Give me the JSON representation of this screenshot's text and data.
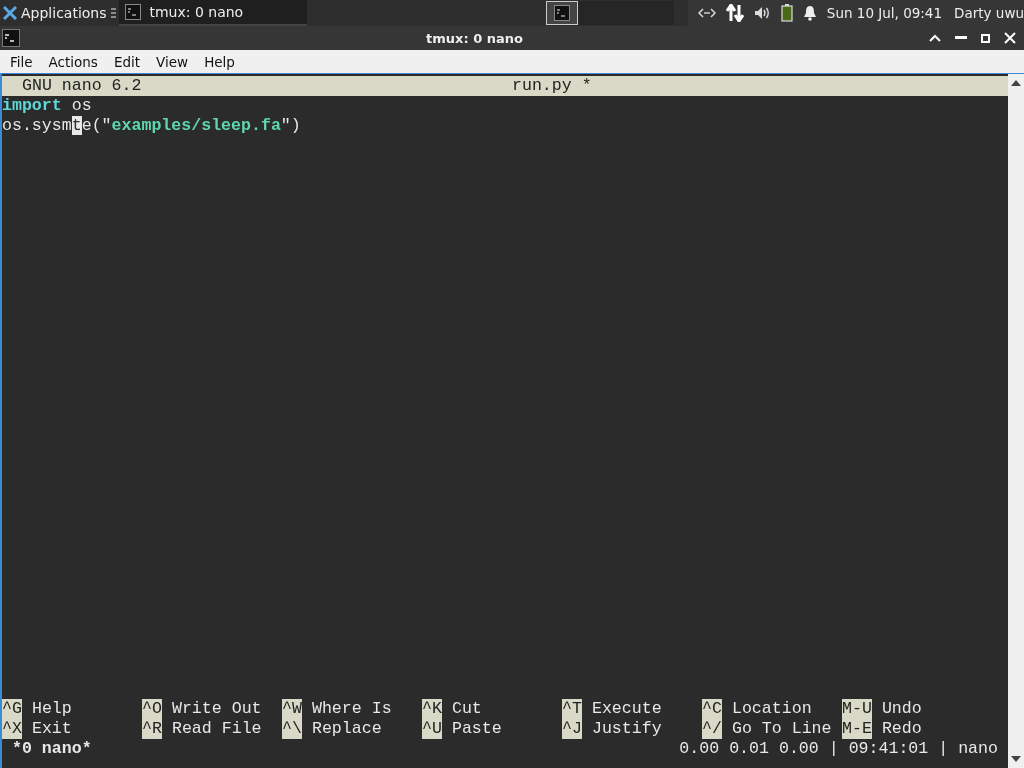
{
  "panel": {
    "app_menu": "Applications",
    "tasks": [
      {
        "title": "tmux: 0 nano",
        "selected": true
      }
    ],
    "workspaces": [
      {
        "selected": true,
        "has_window": true
      },
      {
        "selected": false,
        "has_window": false
      },
      {
        "selected": false,
        "has_window": false
      },
      {
        "selected": false,
        "has_window": false
      }
    ],
    "clock": "Sun 10 Jul, 09:41",
    "user": "Darty uwu"
  },
  "window": {
    "title": "tmux: 0 nano"
  },
  "menu": [
    "File",
    "Actions",
    "Edit",
    "View",
    "Help"
  ],
  "nano": {
    "version": "GNU nano 6.2",
    "filename": "run.py *",
    "lines": [
      [
        {
          "kind": "keyword",
          "text": "import"
        },
        {
          "kind": "plain",
          "text": " os"
        }
      ],
      [
        {
          "kind": "plain",
          "text": "os.sysm"
        },
        {
          "kind": "cursor",
          "text": "t"
        },
        {
          "kind": "plain",
          "text": "e(\""
        },
        {
          "kind": "string",
          "text": "examples/sleep.fa"
        },
        {
          "kind": "plain",
          "text": "\")"
        }
      ]
    ],
    "shortcuts": [
      [
        {
          "key": "^G",
          "label": "Help"
        },
        {
          "key": "^O",
          "label": "Write Out"
        },
        {
          "key": "^W",
          "label": "Where Is"
        },
        {
          "key": "^K",
          "label": "Cut"
        },
        {
          "key": "^T",
          "label": "Execute"
        },
        {
          "key": "^C",
          "label": "Location"
        },
        {
          "key": "M-U",
          "label": "Undo"
        }
      ],
      [
        {
          "key": "^X",
          "label": "Exit"
        },
        {
          "key": "^R",
          "label": "Read File"
        },
        {
          "key": "^\\",
          "label": "Replace"
        },
        {
          "key": "^U",
          "label": "Paste"
        },
        {
          "key": "^J",
          "label": "Justify"
        },
        {
          "key": "^/",
          "label": "Go To Line"
        },
        {
          "key": "M-E",
          "label": "Redo"
        }
      ]
    ]
  },
  "tmux_status": {
    "session": "*0 nano*",
    "right": "0.00 0.01 0.00 | 09:41:01 | nano"
  }
}
